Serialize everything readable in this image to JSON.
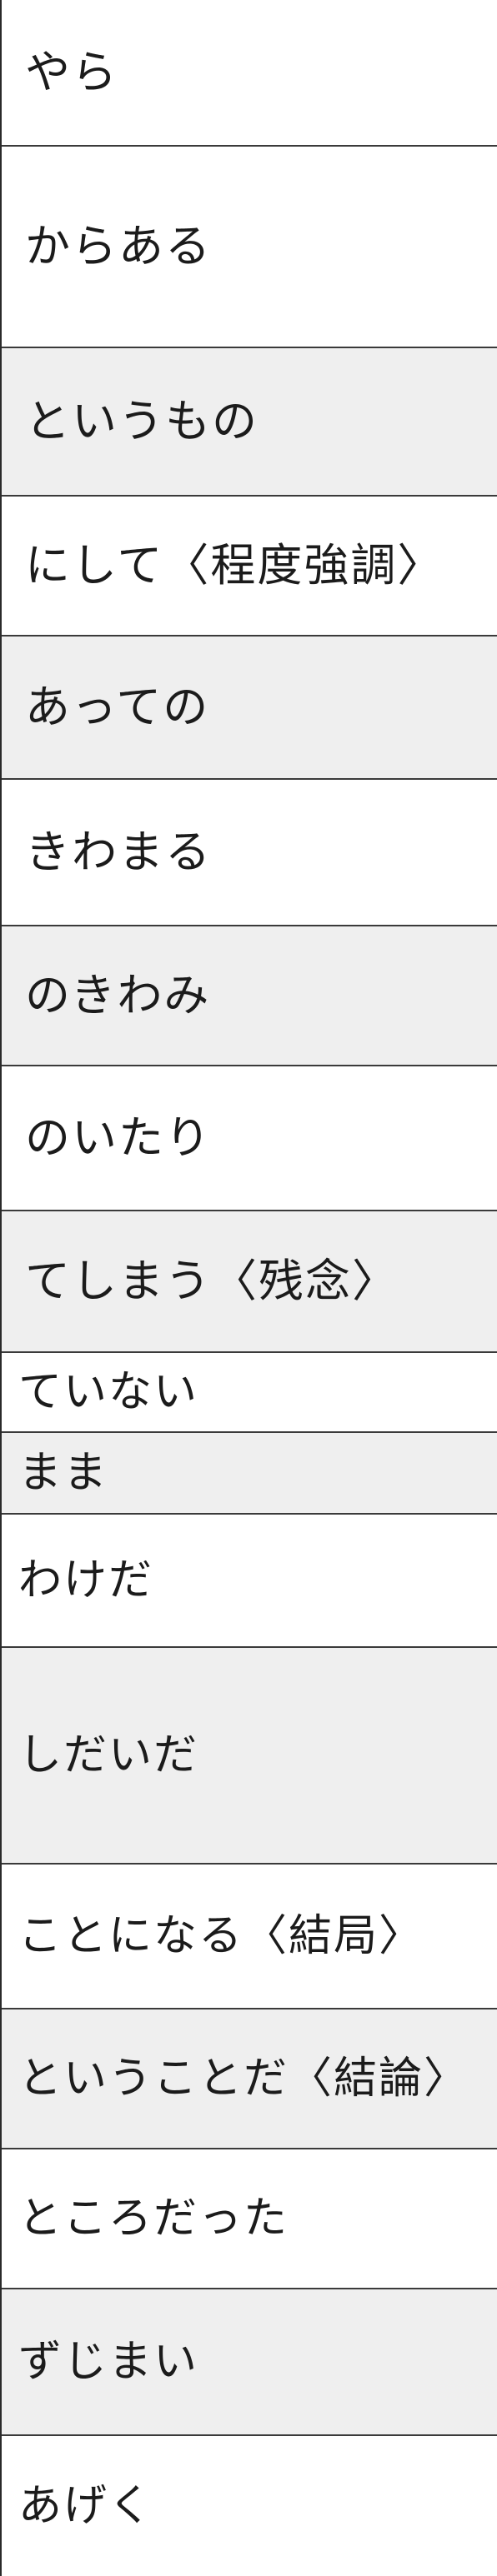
{
  "items": [
    {
      "label": "やら",
      "shade": false
    },
    {
      "label": "からある",
      "shade": false
    },
    {
      "label": "というもの",
      "shade": true
    },
    {
      "label": "にして〈程度強調〉",
      "shade": false
    },
    {
      "label": "あっての",
      "shade": true
    },
    {
      "label": "きわまる",
      "shade": false
    },
    {
      "label": "のきわみ",
      "shade": true
    },
    {
      "label": "のいたり",
      "shade": false
    },
    {
      "label": "てしまう〈残念〉",
      "shade": true
    },
    {
      "label": "ていない",
      "shade": false
    },
    {
      "label": "まま",
      "shade": true
    },
    {
      "label": "わけだ",
      "shade": false
    },
    {
      "label": "しだいだ",
      "shade": true
    },
    {
      "label": "ことになる〈結局〉",
      "shade": false
    },
    {
      "label": "ということだ〈結論〉",
      "shade": true
    },
    {
      "label": "ところだった",
      "shade": false
    },
    {
      "label": "ずじまい",
      "shade": true
    },
    {
      "label": "あげく",
      "shade": false
    }
  ]
}
